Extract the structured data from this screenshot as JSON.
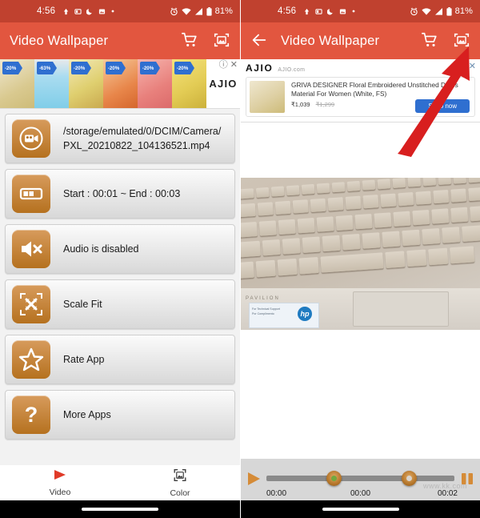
{
  "status_bar": {
    "time": "4:56",
    "battery": "81%",
    "left_icons": [
      "upload-icon",
      "screenshot-icon",
      "dnd-moon-icon",
      "image-icon",
      "dot-icon"
    ],
    "right_icons": [
      "alarm-icon",
      "wifi-icon",
      "signal-icon",
      "battery-icon"
    ],
    "background": "#c0412f"
  },
  "app_bar": {
    "title": "Video Wallpaper",
    "background": "#e2563f",
    "cart_icon": "shopping-cart-icon",
    "wallpaper_icon": "set-wallpaper-icon",
    "back_icon": "back-arrow-icon"
  },
  "left_screen": {
    "ad_carousel": {
      "brand": "AJIO",
      "thumbs": [
        {
          "discount": "-20%"
        },
        {
          "discount": "-63%"
        },
        {
          "discount": "-20%"
        },
        {
          "discount": "-20%"
        },
        {
          "discount": "-20%"
        },
        {
          "discount": "-20%"
        }
      ],
      "info_icon": "ad-info-icon",
      "close_icon": "ad-close-icon"
    },
    "list": [
      {
        "icon": "video-camera-icon",
        "label": "/storage/emulated/0/DCIM/Camera/\nPXL_20210822_104136521.mp4"
      },
      {
        "icon": "trim-range-icon",
        "label": "Start : 00:01 ~ End : 00:03"
      },
      {
        "icon": "audio-muted-icon",
        "label": "Audio is disabled"
      },
      {
        "icon": "scale-fit-icon",
        "label": "Scale Fit"
      },
      {
        "icon": "star-icon",
        "label": "Rate App"
      },
      {
        "icon": "question-mark-icon",
        "label": "More Apps"
      }
    ],
    "bottom_nav": [
      {
        "icon": "play-triangle-icon",
        "label": "Video",
        "active": true
      },
      {
        "icon": "color-frame-icon",
        "label": "Color",
        "active": false
      }
    ]
  },
  "right_screen": {
    "ad_card": {
      "brand": "AJIO",
      "url": "AJIO.com",
      "headline": "GRIVA DESIGNER Floral Embroidered Unstitched Dress Material For Women (White, FS)",
      "price": "₹1,039",
      "old_price": "₹1,299",
      "cta": "Shop now",
      "info_icon": "ad-info-icon",
      "close_icon": "ad-close-icon"
    },
    "preview": {
      "description": "HP Pavilion laptop keyboard video frame",
      "brand_text": "PAVILION",
      "logo_text": "hp"
    },
    "player": {
      "play_icon": "play-icon",
      "pause_icon": "pause-icon",
      "start_time": "00:00",
      "current_time": "00:00",
      "end_time": "00:02",
      "knob_color": "#b5762a",
      "watermark": "www.kk.com"
    },
    "annotation": {
      "arrow_color": "#d81f1f",
      "points_at": "set-wallpaper-icon"
    }
  }
}
